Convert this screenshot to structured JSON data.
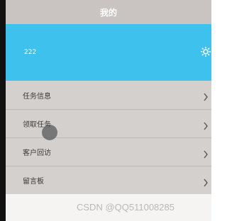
{
  "header": {
    "title": "我的"
  },
  "profile": {
    "username": "222",
    "settings_icon": "gear-icon",
    "background_color": "#3fc1ee"
  },
  "menu": {
    "items": [
      {
        "label": "任务信息",
        "icon": "chevron-right-icon"
      },
      {
        "label": "领取任务",
        "icon": "chevron-right-icon"
      },
      {
        "label": "客户回访",
        "icon": "chevron-right-icon"
      },
      {
        "label": "留言板",
        "icon": "chevron-right-icon"
      }
    ]
  },
  "watermark": {
    "text": "CSDN @QQ511008285"
  }
}
